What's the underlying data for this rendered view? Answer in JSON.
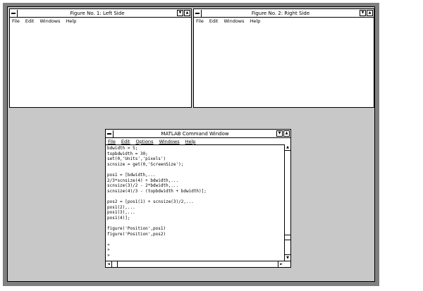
{
  "figure1": {
    "title": "Figure No. 1: Left Side",
    "menu": [
      "File",
      "Edit",
      "Windows",
      "Help"
    ]
  },
  "figure2": {
    "title": "Figure No. 2: Right Side",
    "menu": [
      "File",
      "Edit",
      "Windows",
      "Help"
    ]
  },
  "command_window": {
    "title": "MATLAB Command Window",
    "menu": [
      "File",
      "Edit",
      "Options",
      "Windows",
      "Help"
    ],
    "lines": [
      "bdwidth = 5;",
      "topbdwidth = 30;",
      "set(0,'Units','pixels')",
      "scnsize = get(0,'ScreenSize');",
      "",
      "pos1 = [bdwidth,...",
      "2/3*scnsize(4) + bdwidth,...",
      "scnsize(3)/2 - 2*bdwidth,...",
      "scnsize(4)/3 - (topbdwidth + bdwidth)];",
      "",
      "pos2 = [pos1(1) + scnsize(3)/2,...",
      "pos1(2),...",
      "pos1(3),...",
      "pos1(4)];",
      "",
      "figure('Position',pos1)",
      "figure('Position',pos2)",
      "",
      "»",
      "»",
      "»"
    ]
  },
  "icons": {
    "minimize": "▼",
    "maximize": "▲",
    "scroll_up": "▲",
    "scroll_down": "▼",
    "scroll_left": "◄",
    "scroll_right": "►"
  }
}
